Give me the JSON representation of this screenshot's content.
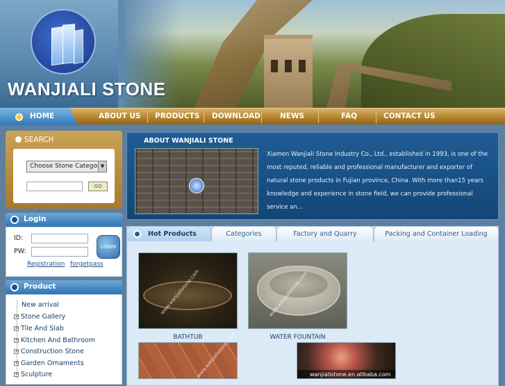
{
  "brand": {
    "name": "WANJIALI STONE"
  },
  "nav": {
    "items": [
      "HOME",
      "ABOUT US",
      "PRODUCTS",
      "DOWNLOAD",
      "NEWS",
      "FAQ",
      "CONTACT US"
    ]
  },
  "search": {
    "title": "SEARCH",
    "category_select": "Choose Stone Category",
    "keyword_value": "",
    "go_label": "GO"
  },
  "login": {
    "title": "Login",
    "id_label": "ID:",
    "pw_label": "PW:",
    "button_label": "LOGIN",
    "registration_link": "Registration",
    "forget_link": "forgetpass"
  },
  "product_menu": {
    "title": "Product",
    "items": [
      {
        "label": "New arrival",
        "expandable": false
      },
      {
        "label": "Stone Gallery",
        "expandable": true
      },
      {
        "label": "Tile And Slab",
        "expandable": true
      },
      {
        "label": "Kitchen And Bathroom",
        "expandable": true
      },
      {
        "label": "Construction Stone",
        "expandable": true
      },
      {
        "label": "Garden Ornaments",
        "expandable": true
      },
      {
        "label": "Sculpture",
        "expandable": true
      }
    ]
  },
  "about": {
    "heading": "ABOUT WANJIALI STONE",
    "text": "Xiamen Wanjiali Stone Industry Co., Ltd., established in 1993, is one of the most reputed, reliable and professional manufacturer and exporter of natural stone products in Fujian province, China. With more than15 years knowledge and experience in stone field, we can provide professional service an..."
  },
  "tabs": {
    "items": [
      "Hot Products",
      "Categories",
      "Factory and Quarry",
      "Packing and Container Loading"
    ],
    "active": 0
  },
  "products": [
    {
      "caption": "BATHTUB",
      "watermark": "www.wanjialistone.com"
    },
    {
      "caption": "WATER FOUNTAIN",
      "watermark": "www.wanjialistone.com"
    },
    {
      "caption": "",
      "watermark": "www.wanjialistone.com"
    },
    {
      "caption": "",
      "watermark": "wanjialistone.en.alibaba.com"
    }
  ],
  "colors": {
    "nav_gold": "#b9892f",
    "accent_blue": "#2f74b4",
    "about_bg": "#1f5c94",
    "panel_bg": "#dce9f6"
  }
}
